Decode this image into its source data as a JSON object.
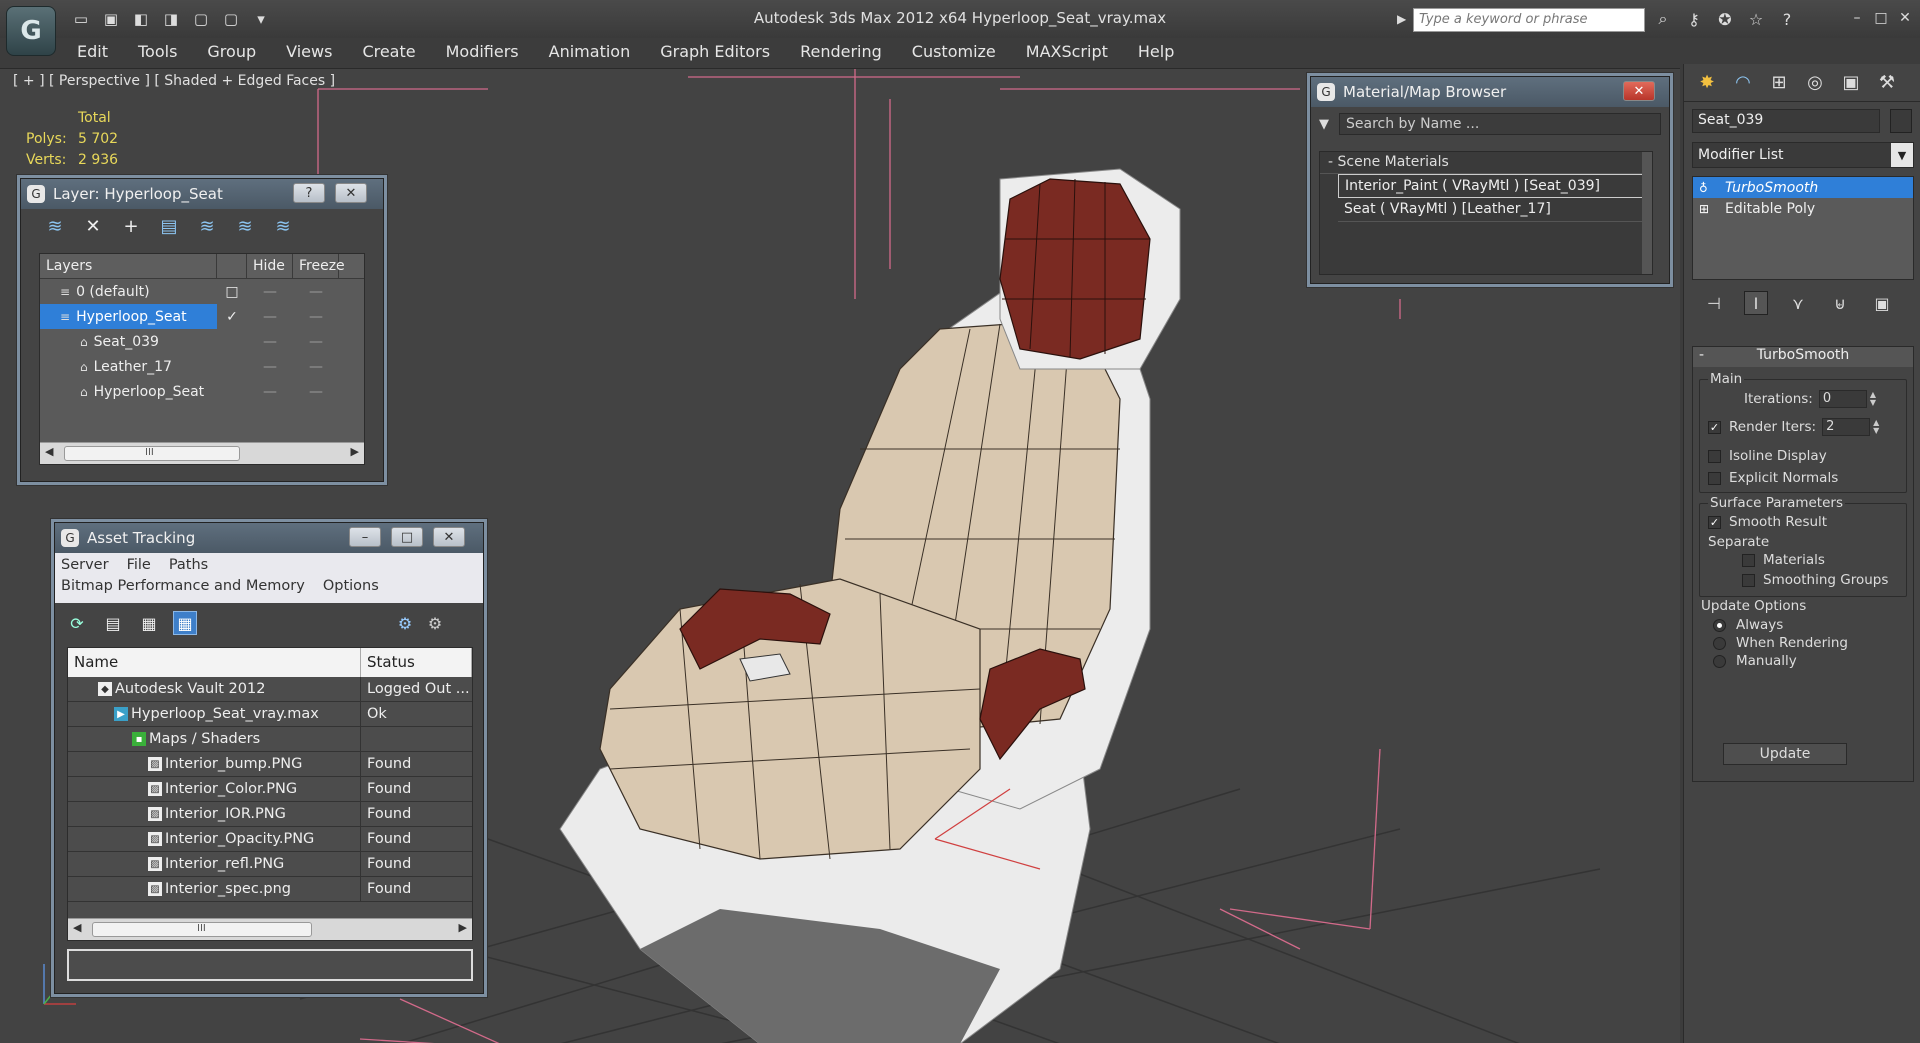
{
  "app": {
    "logo": "3ds-max-logo",
    "title": "Autodesk 3ds Max  2012 x64      Hyperloop_Seat_vray.max",
    "search_placeholder": "Type a keyword or phrase"
  },
  "menu": [
    "Edit",
    "Tools",
    "Group",
    "Views",
    "Create",
    "Modifiers",
    "Animation",
    "Graph Editors",
    "Rendering",
    "Customize",
    "MAXScript",
    "Help"
  ],
  "viewport": {
    "label": "[ + ] [ Perspective ] [ Shaded + Edged Faces ]",
    "stats": {
      "total_label": "Total",
      "polys_label": "Polys:",
      "polys_value": "5 702",
      "verts_label": "Verts:",
      "verts_value": "2 936"
    }
  },
  "layer_dialog": {
    "title": "Layer: Hyperloop_Seat",
    "help_btn": "?",
    "close_btn": "✕",
    "columns": {
      "layers": "Layers",
      "hide": "Hide",
      "freeze": "Freeze"
    },
    "rows": [
      {
        "name": "0 (default)",
        "indent": 0,
        "check": "□"
      },
      {
        "name": "Hyperloop_Seat",
        "indent": 0,
        "check": "✓",
        "selected": true
      },
      {
        "name": "Seat_039",
        "indent": 1,
        "check": ""
      },
      {
        "name": "Leather_17",
        "indent": 1,
        "check": ""
      },
      {
        "name": "Hyperloop_Seat",
        "indent": 1,
        "check": ""
      }
    ],
    "scroll_grip": "III"
  },
  "asset_dialog": {
    "title": "Asset Tracking",
    "menu_row1": [
      "Server",
      "File",
      "Paths"
    ],
    "menu_row2": [
      "Bitmap Performance and Memory",
      "Options"
    ],
    "columns": {
      "name": "Name",
      "status": "Status"
    },
    "rows": [
      {
        "name": "Autodesk Vault 2012",
        "status": "Logged Out ...",
        "indent": 1
      },
      {
        "name": "Hyperloop_Seat_vray.max",
        "status": "Ok",
        "indent": 2
      },
      {
        "name": "Maps / Shaders",
        "status": "",
        "indent": 3
      },
      {
        "name": "Interior_bump.PNG",
        "status": "Found",
        "indent": 4
      },
      {
        "name": "Interior_Color.PNG",
        "status": "Found",
        "indent": 4
      },
      {
        "name": "Interior_IOR.PNG",
        "status": "Found",
        "indent": 4
      },
      {
        "name": "Interior_Opacity.PNG",
        "status": "Found",
        "indent": 4
      },
      {
        "name": "Interior_refl.PNG",
        "status": "Found",
        "indent": 4
      },
      {
        "name": "Interior_spec.png",
        "status": "Found",
        "indent": 4
      }
    ],
    "scroll_grip": "III"
  },
  "material_browser": {
    "title": "Material/Map Browser",
    "search_placeholder": "Search by Name ...",
    "group": "- Scene Materials",
    "items": [
      "Interior_Paint  ( VRayMtl )  [Seat_039]",
      "Seat  ( VRayMtl )  [Leather_17]"
    ]
  },
  "command_panel": {
    "object_name": "Seat_039",
    "modifier_list": "Modifier List",
    "stack": [
      {
        "label": "TurboSmooth",
        "selected": true
      },
      {
        "label": "Editable Poly",
        "selected": false
      }
    ],
    "rollout": {
      "title": "TurboSmooth",
      "main_label": "Main",
      "iterations_label": "Iterations:",
      "iterations_value": "0",
      "render_iters_label": "Render Iters:",
      "render_iters_value": "2",
      "render_iters_checked": true,
      "isoline_label": "Isoline Display",
      "explicit_label": "Explicit Normals",
      "surface_label": "Surface Parameters",
      "smooth_result_label": "Smooth Result",
      "smooth_result_checked": true,
      "separate_label": "Separate",
      "materials_label": "Materials",
      "smoothing_groups_label": "Smoothing Groups",
      "update_options_label": "Update Options",
      "always_label": "Always",
      "when_rendering_label": "When Rendering",
      "manually_label": "Manually",
      "update_selected": "Always",
      "update_button": "Update"
    }
  },
  "colors": {
    "selection_blue": "#2f7fd8",
    "stats_yellow": "#e8d85a",
    "leather_red": "#7a2a22",
    "seat_beige": "#d9c8b0",
    "grid_pink": "#d26a8a"
  }
}
